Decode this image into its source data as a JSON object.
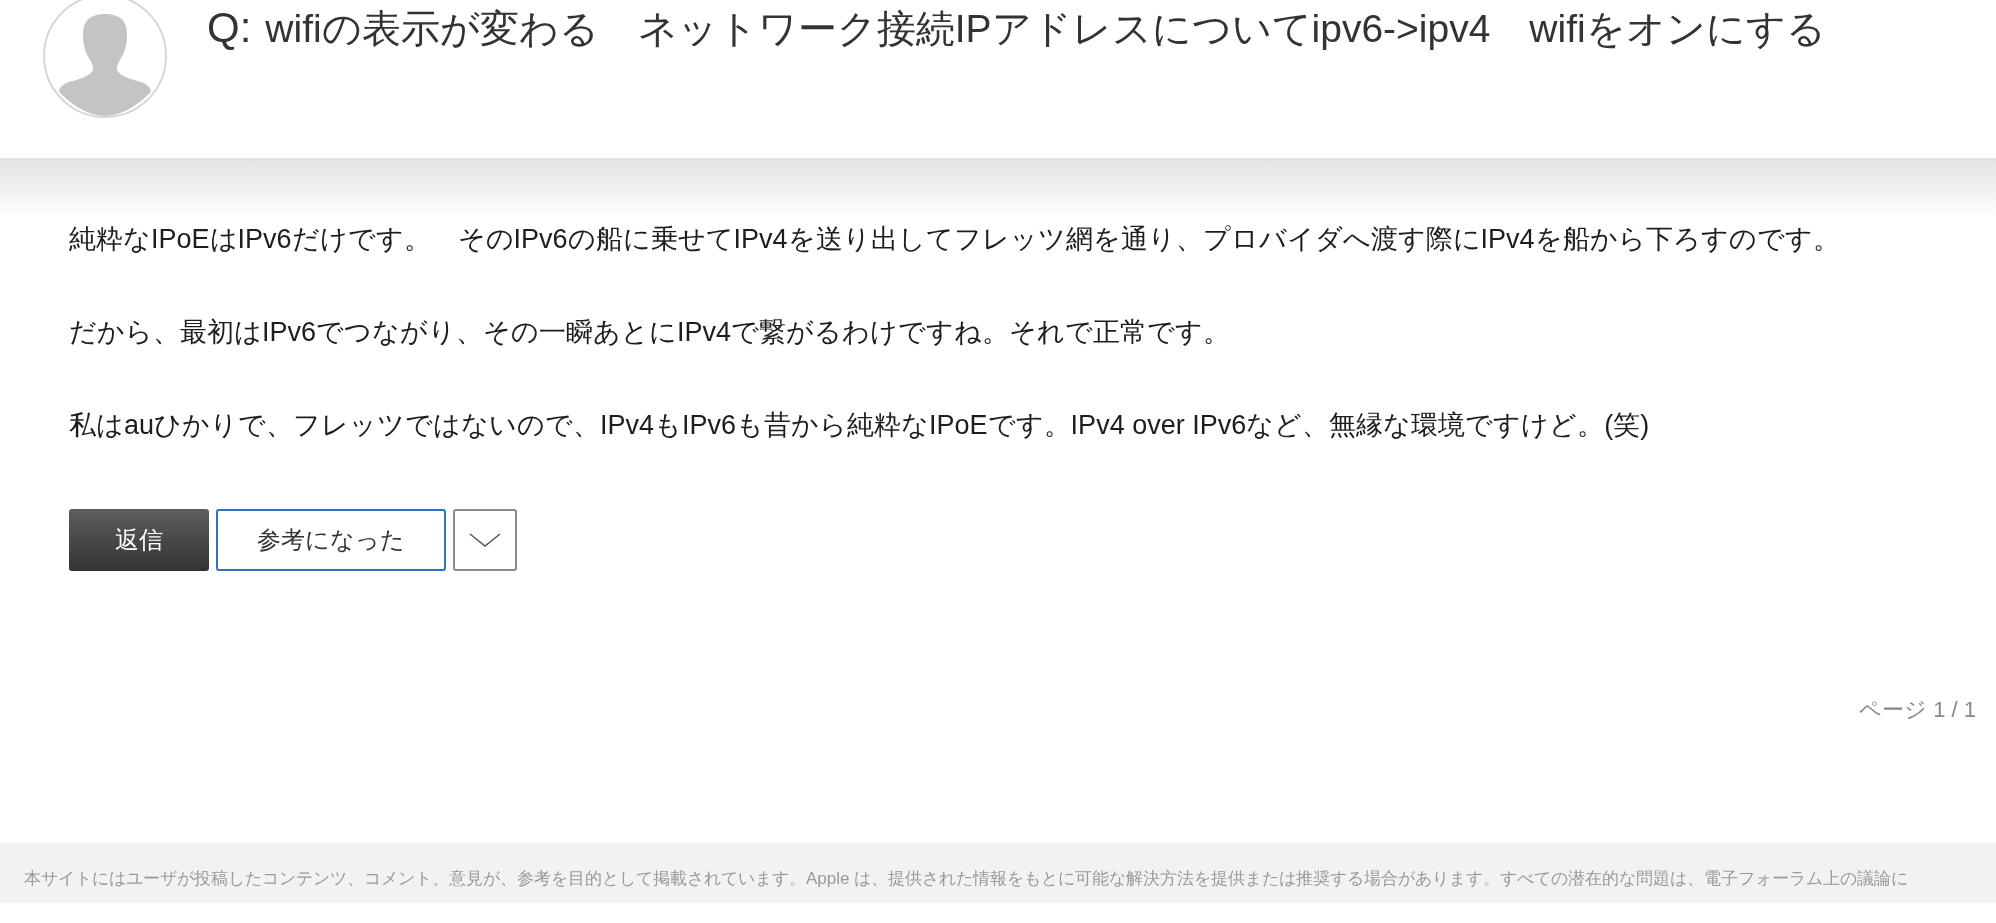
{
  "question": {
    "prefix": "Q:",
    "title": "wifiの表示が変わる　ネットワーク接続IPアドレスについてipv6->ipv4　wifiをオンにする"
  },
  "answer": {
    "paragraphs": [
      "純粋なIPoEはIPv6だけです。　そのIPv6の船に乗せてIPv4を送り出してフレッツ網を通り、プロバイダへ渡す際にIPv4を船から下ろすのです。",
      "だから、最初はIPv6でつながり、その一瞬あとにIPv4で繋がるわけですね。それで正常です。",
      "私はauひかりで、フレッツではないので、IPv4もIPv6も昔から純粋なIPoEです。IPv4 over IPv6など、無縁な環境ですけど。(笑)"
    ],
    "buttons": [
      {
        "kind": "reply",
        "label": "返信"
      },
      {
        "kind": "helpful",
        "label": "参考になった"
      },
      {
        "kind": "more"
      }
    ]
  },
  "pagination": "ページ 1 / 1",
  "footer": "本サイトにはユーザが投稿したコンテンツ、コメント、意見が、参考を目的として掲載されています。Apple は、提供された情報をもとに可能な解決方法を提供または推奨する場合があります。すべての潜在的な問題は、電子フォーラム上の議論に"
}
